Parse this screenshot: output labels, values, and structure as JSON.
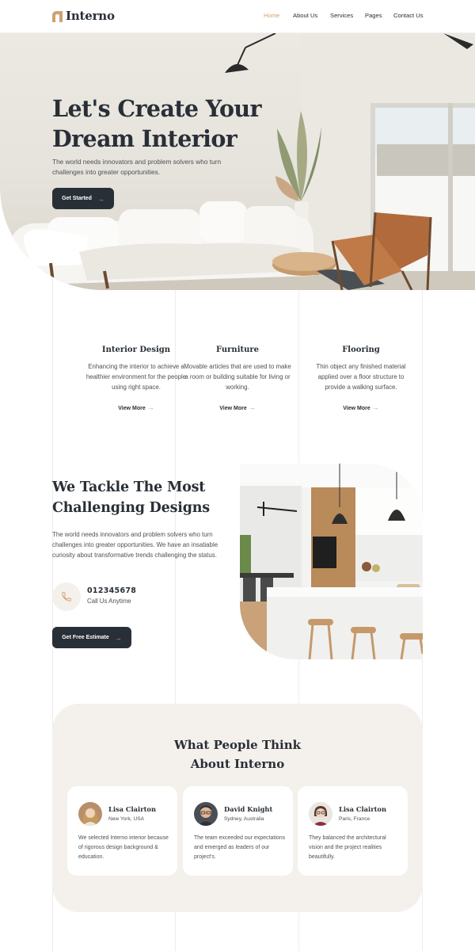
{
  "brand": {
    "name": "Interno",
    "accent": "#CDA274",
    "dark": "#292F36",
    "cream": "#F4F0EC"
  },
  "nav": {
    "items": [
      {
        "label": "Home",
        "active": true
      },
      {
        "label": "About Us",
        "active": false
      },
      {
        "label": "Services",
        "active": false
      },
      {
        "label": "Pages",
        "active": false
      },
      {
        "label": "Contact Us",
        "active": false
      }
    ]
  },
  "hero": {
    "title_line1": "Let's Create Your",
    "title_line2": "Dream Interior",
    "text": "The world needs innovators and problem solvers who turn challenges into greater opportunities.",
    "button_label": "Get Started",
    "button_icon": "arrow-right-icon"
  },
  "services": [
    {
      "title": "Interior Design",
      "text": "Enhancing the interior to achieve a healthier environment for the people using right space.",
      "link": "View More"
    },
    {
      "title": "Furniture",
      "text": "Movable articles that are used to make a room or building suitable for living or working.",
      "link": "View More"
    },
    {
      "title": "Flooring",
      "text": "Thin object any finished material applied over a floor structure to provide a walking surface.",
      "link": "View More"
    }
  ],
  "tackle": {
    "title_line1": "We Tackle The Most",
    "title_line2": "Challenging Designs",
    "text": "The world needs innovators and problem solvers who turn challenges into greater opportunities. We have an insatiable curiosity about transformative trends challenging the status.",
    "phone": "012345678",
    "phone_caption": "Call Us Anytime",
    "phone_icon": "phone-icon",
    "button_label": "Get Free Estimate"
  },
  "testimonials": {
    "title_line1": "What People Think",
    "title_line2": "About Interno",
    "items": [
      {
        "name": "Lisa Clairton",
        "location": "New York, USA",
        "quote": "We selected Interno interior because of rigorous design background & education."
      },
      {
        "name": "David Knight",
        "location": "Sydney, Australia",
        "quote": "The team exceeded our expectations and emerged as leaders of our project's."
      },
      {
        "name": "Lisa Clairton",
        "location": "Paris, France",
        "quote": "They balanced the architectural vision and the project realities beautifully."
      }
    ]
  }
}
